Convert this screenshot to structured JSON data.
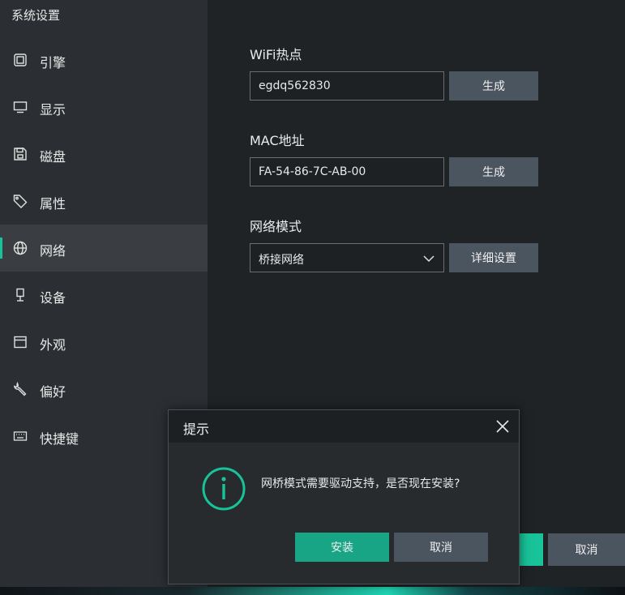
{
  "colors": {
    "accent": "#18c39a",
    "sidebar_bg": "#2b2f33",
    "main_bg": "#1f2326",
    "button_bg": "#4b5560",
    "dialog_bg": "#272b2e"
  },
  "sidebar": {
    "title": "系统设置",
    "items": [
      {
        "label": "引擎",
        "icon": "cpu-icon"
      },
      {
        "label": "显示",
        "icon": "monitor-icon"
      },
      {
        "label": "磁盘",
        "icon": "save-disk-icon"
      },
      {
        "label": "属性",
        "icon": "tag-icon"
      },
      {
        "label": "网络",
        "icon": "globe-icon",
        "active": true
      },
      {
        "label": "设备",
        "icon": "usb-device-icon"
      },
      {
        "label": "外观",
        "icon": "window-icon"
      },
      {
        "label": "偏好",
        "icon": "wrench-icon"
      },
      {
        "label": "快捷键",
        "icon": "keyboard-icon"
      }
    ]
  },
  "main": {
    "wifi": {
      "label": "WiFi热点",
      "value": "egdq562830",
      "button": "生成"
    },
    "mac": {
      "label": "MAC地址",
      "value": "FA-54-86-7C-AB-00",
      "button": "生成"
    },
    "network_mode": {
      "label": "网络模式",
      "selected": "桥接网络",
      "button": "详细设置"
    },
    "footer": {
      "cancel": "取消"
    }
  },
  "dialog": {
    "title": "提示",
    "message": "网桥模式需要驱动支持，是否现在安装?",
    "icon": "info-icon",
    "confirm": "安装",
    "cancel": "取消"
  }
}
